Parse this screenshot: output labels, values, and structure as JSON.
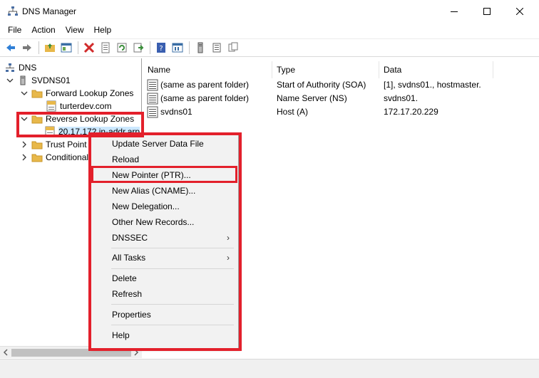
{
  "window": {
    "title": "DNS Manager",
    "minimize_glyph": "—",
    "maximize_glyph": "☐",
    "close_glyph": "✕"
  },
  "menubar": {
    "items": [
      {
        "label": "File"
      },
      {
        "label": "Action"
      },
      {
        "label": "View"
      },
      {
        "label": "Help"
      }
    ]
  },
  "toolbar": {
    "icons": [
      "back-icon",
      "forward-icon",
      "up-folder-icon",
      "show-hide-tree-icon",
      "delete-icon",
      "properties-icon",
      "refresh-icon",
      "export-list-icon",
      "help-icon",
      "console-icon",
      "server-icon",
      "list-icon",
      "copy-icon"
    ]
  },
  "tree": {
    "root": "DNS",
    "server": "SVDNS01",
    "forward_zones": "Forward Lookup Zones",
    "forward_child": "turterdev.com",
    "reverse_zones": "Reverse Lookup Zones",
    "reverse_child": "20.17.172.in-addr.arp",
    "trust_points": "Trust Point",
    "conditional": "Conditional"
  },
  "list": {
    "columns": [
      "Name",
      "Type",
      "Data"
    ],
    "rows": [
      {
        "name": "(same as parent folder)",
        "type": "Start of Authority (SOA)",
        "data": "[1], svdns01., hostmaster."
      },
      {
        "name": "(same as parent folder)",
        "type": "Name Server (NS)",
        "data": "svdns01."
      },
      {
        "name": "svdns01",
        "type": "Host (A)",
        "data": "172.17.20.229"
      }
    ]
  },
  "context_menu": {
    "items": [
      {
        "label": "Update Server Data File"
      },
      {
        "label": "Reload"
      },
      {
        "label": "New Pointer (PTR)..."
      },
      {
        "label": "New Alias (CNAME)..."
      },
      {
        "label": "New Delegation..."
      },
      {
        "label": "Other New Records..."
      },
      {
        "label": "DNSSEC"
      },
      {
        "label": "All Tasks"
      },
      {
        "label": "Delete"
      },
      {
        "label": "Refresh"
      },
      {
        "label": "Properties"
      },
      {
        "label": "Help"
      }
    ],
    "submenu_arrow": "›"
  },
  "colors": {
    "annotation": "#e3202b",
    "selection": "#cce8ff",
    "folder": "#e8b84a"
  }
}
